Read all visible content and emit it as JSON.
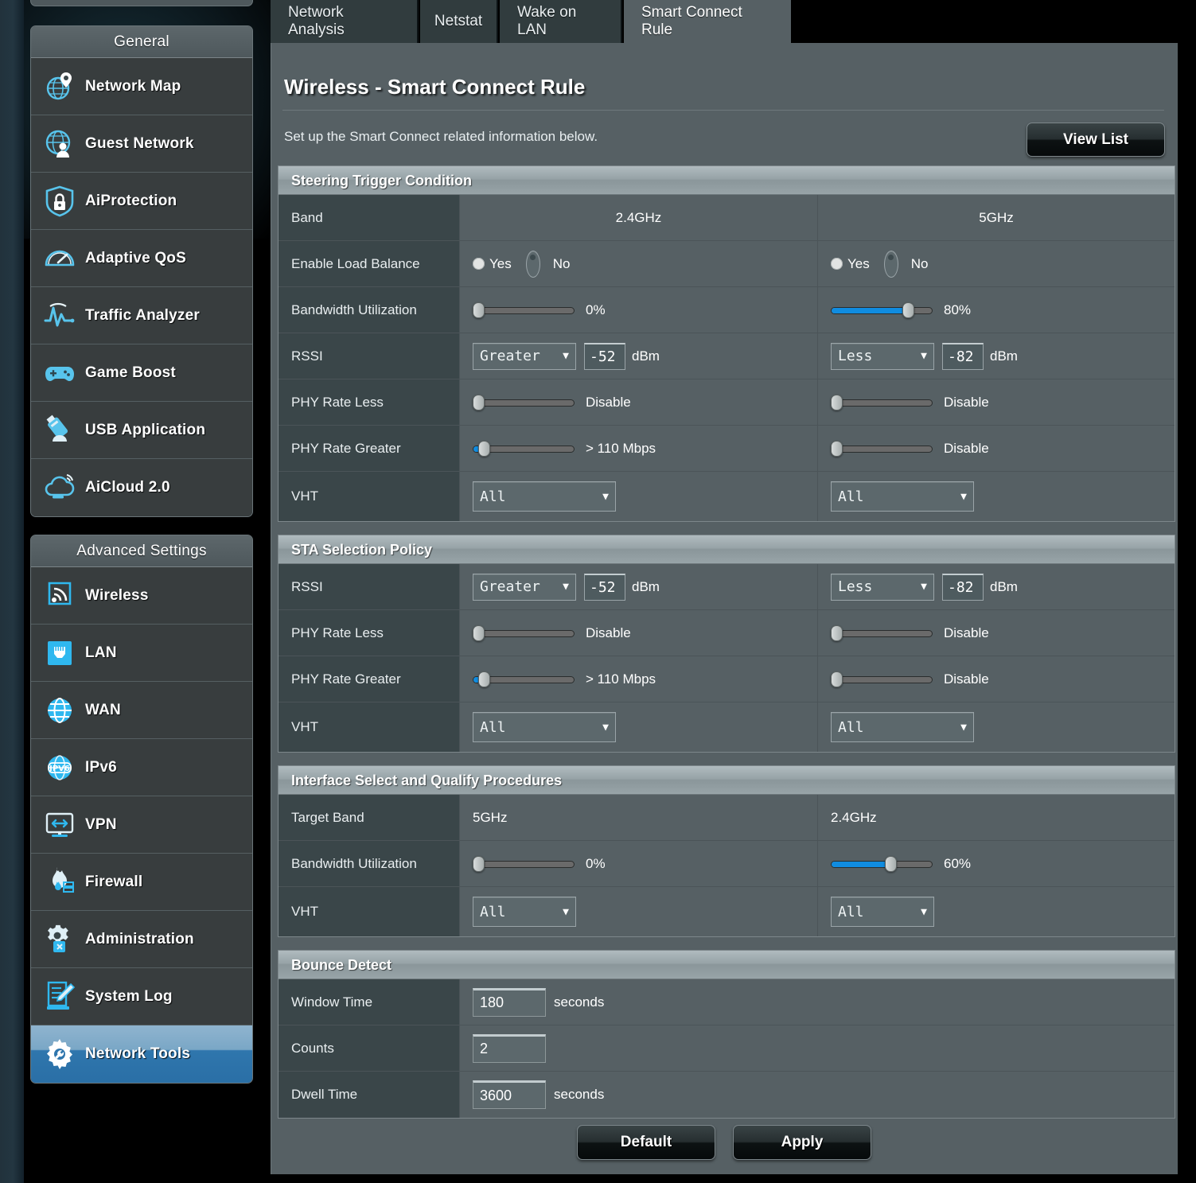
{
  "tabs": [
    {
      "label": "Network Analysis",
      "active": false
    },
    {
      "label": "Netstat",
      "active": false
    },
    {
      "label": "Wake on LAN",
      "active": false
    },
    {
      "label": "Smart Connect Rule",
      "active": true
    }
  ],
  "sidebar": {
    "general": {
      "title": "General",
      "items": [
        {
          "label": "Network Map",
          "icon": "network-map-icon"
        },
        {
          "label": "Guest Network",
          "icon": "guest-network-icon"
        },
        {
          "label": "AiProtection",
          "icon": "shield-lock-icon"
        },
        {
          "label": "Adaptive QoS",
          "icon": "speedometer-icon"
        },
        {
          "label": "Traffic Analyzer",
          "icon": "traffic-graph-icon"
        },
        {
          "label": "Game Boost",
          "icon": "gamepad-icon"
        },
        {
          "label": "USB Application",
          "icon": "usb-drive-icon"
        },
        {
          "label": "AiCloud 2.0",
          "icon": "cloud-icon"
        }
      ]
    },
    "advanced": {
      "title": "Advanced Settings",
      "items": [
        {
          "label": "Wireless",
          "icon": "wifi-icon"
        },
        {
          "label": "LAN",
          "icon": "lan-port-icon"
        },
        {
          "label": "WAN",
          "icon": "globe-icon"
        },
        {
          "label": "IPv6",
          "icon": "ipv6-globe-icon"
        },
        {
          "label": "VPN",
          "icon": "vpn-monitor-icon"
        },
        {
          "label": "Firewall",
          "icon": "firewall-flame-icon"
        },
        {
          "label": "Administration",
          "icon": "gear-wrench-icon"
        },
        {
          "label": "System Log",
          "icon": "log-pencil-icon"
        },
        {
          "label": "Network Tools",
          "icon": "gear-tools-icon",
          "active": true
        }
      ]
    }
  },
  "page": {
    "title": "Wireless - Smart Connect Rule",
    "description": "Set up the Smart Connect related information below.",
    "view_list_label": "View List"
  },
  "colors": {
    "accent_blue": "#108ce0",
    "panel_bg": "#566064",
    "label_bg": "#3a4649",
    "section_header": "#97a3a7",
    "active_nav": "#2f76ad"
  },
  "sections": {
    "steering": {
      "title": "Steering Trigger Condition",
      "rows": {
        "band": {
          "label": "Band",
          "col24": "2.4GHz",
          "col5": "5GHz"
        },
        "load_balance": {
          "label": "Enable Load Balance",
          "yes_label": "Yes",
          "no_label": "No",
          "col24_selected": "No",
          "col5_selected": "No"
        },
        "bandwidth": {
          "label": "Bandwidth Utilization",
          "col24_value": "0%",
          "col24_pct": 0,
          "col5_value": "80%",
          "col5_pct": 80
        },
        "rssi": {
          "label": "RSSI",
          "col24_op": "Greater",
          "col24_num": "-52",
          "col24_unit": "dBm",
          "col5_op": "Less",
          "col5_num": "-82",
          "col5_unit": "dBm"
        },
        "phy_less": {
          "label": "PHY Rate Less",
          "col24_value": "Disable",
          "col24_pct": 0,
          "col5_value": "Disable",
          "col5_pct": 0
        },
        "phy_greater": {
          "label": "PHY Rate Greater",
          "col24_value": "> 110 Mbps",
          "col24_pct": 6,
          "col5_value": "Disable",
          "col5_pct": 0
        },
        "vht": {
          "label": "VHT",
          "col24_value": "All",
          "col5_value": "All"
        }
      }
    },
    "sta": {
      "title": "STA Selection Policy",
      "rows": {
        "rssi": {
          "label": "RSSI",
          "col24_op": "Greater",
          "col24_num": "-52",
          "col24_unit": "dBm",
          "col5_op": "Less",
          "col5_num": "-82",
          "col5_unit": "dBm"
        },
        "phy_less": {
          "label": "PHY Rate Less",
          "col24_value": "Disable",
          "col24_pct": 0,
          "col5_value": "Disable",
          "col5_pct": 0
        },
        "phy_greater": {
          "label": "PHY Rate Greater",
          "col24_value": "> 110 Mbps",
          "col24_pct": 6,
          "col5_value": "Disable",
          "col5_pct": 0
        },
        "vht": {
          "label": "VHT",
          "col24_value": "All",
          "col5_value": "All"
        }
      }
    },
    "interface": {
      "title": "Interface Select and Qualify Procedures",
      "rows": {
        "target_band": {
          "label": "Target Band",
          "col1": "5GHz",
          "col2": "2.4GHz"
        },
        "bandwidth": {
          "label": "Bandwidth Utilization",
          "col1_value": "0%",
          "col1_pct": 0,
          "col2_value": "60%",
          "col2_pct": 60
        },
        "vht": {
          "label": "VHT",
          "col1_value": "All",
          "col2_value": "All"
        }
      }
    },
    "bounce": {
      "title": "Bounce Detect",
      "rows": {
        "window_time": {
          "label": "Window Time",
          "value": "180",
          "unit": "seconds"
        },
        "counts": {
          "label": "Counts",
          "value": "2",
          "unit": ""
        },
        "dwell_time": {
          "label": "Dwell Time",
          "value": "3600",
          "unit": "seconds"
        }
      }
    }
  },
  "footer": {
    "default_label": "Default",
    "apply_label": "Apply"
  }
}
